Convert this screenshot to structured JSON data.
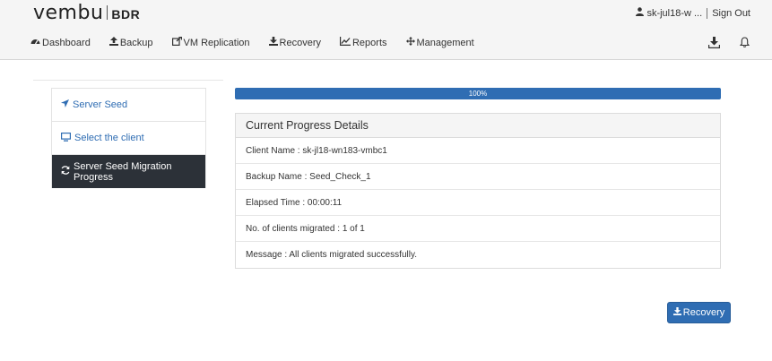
{
  "header": {
    "logo_word": "vembu",
    "logo_product": "BDR",
    "user": "sk-jul18-w ...",
    "sign_out": "Sign Out"
  },
  "nav": [
    {
      "label": "Dashboard",
      "icon": "dashboard-icon"
    },
    {
      "label": "Backup",
      "icon": "upload-icon"
    },
    {
      "label": "VM Replication",
      "icon": "external-link-icon"
    },
    {
      "label": "Recovery",
      "icon": "download-icon"
    },
    {
      "label": "Reports",
      "icon": "line-chart-icon"
    },
    {
      "label": "Management",
      "icon": "arrows-icon"
    }
  ],
  "header_icons": [
    "download-tray-icon",
    "bell-icon"
  ],
  "sidebar": {
    "items": [
      {
        "label": "Server Seed",
        "icon": "location-arrow-icon"
      },
      {
        "label": "Select the client",
        "icon": "monitor-icon"
      },
      {
        "label": "Server Seed Migration Progress",
        "icon": "refresh-icon"
      }
    ],
    "active_index": 2
  },
  "progress": {
    "value": 1.0,
    "label": "100%"
  },
  "details": {
    "title": "Current Progress Details",
    "rows": [
      "Client Name : sk-jl18-wn183-vmbc1",
      "Backup Name : Seed_Check_1",
      "Elapsed Time : 00:00:11",
      "No. of clients migrated : 1 of 1",
      "Message : All clients migrated successfully."
    ]
  },
  "actions": {
    "recovery_label": "Recovery"
  },
  "colors": {
    "accent": "#2f6db3",
    "sidebar_active": "#2c3138",
    "header_bg": "#f5f5f5"
  }
}
